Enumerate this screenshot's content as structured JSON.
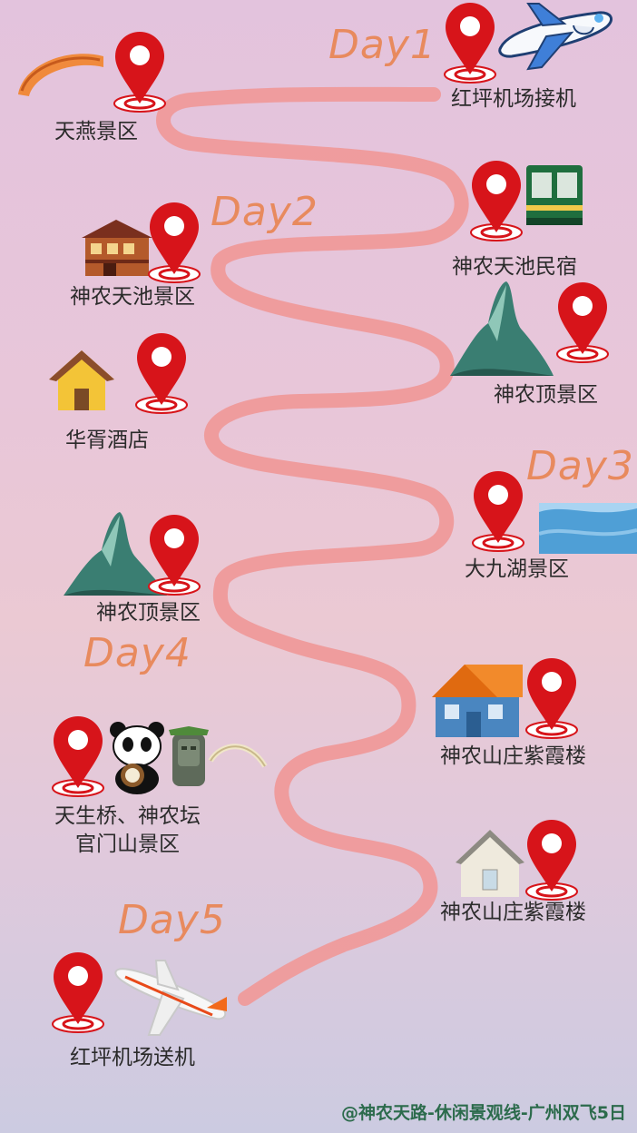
{
  "days": {
    "d1": "Day1",
    "d2": "Day2",
    "d3": "Day3",
    "d4": "Day4",
    "d5": "Day5"
  },
  "stops": {
    "s1": "红坪机场接机",
    "s2": "天燕景区",
    "s3": "神农天池民宿",
    "s4": "神农天池景区",
    "s5": "神农顶景区",
    "s6": "华胥酒店",
    "s7": "大九湖景区",
    "s8": "神农顶景区",
    "s9": "神农山庄紫霞楼",
    "s10_line1": "天生桥、神农坛",
    "s10_line2": "官门山景区",
    "s11": "神农山庄紫霞楼",
    "s12": "红坪机场送机"
  },
  "footer": "@神农天路-休闲景观线-广州双飞5日",
  "colors": {
    "route": "#ef9a9a",
    "pin": "#d7141a",
    "day": "#e88a5e",
    "footer": "#2c6b4c"
  }
}
